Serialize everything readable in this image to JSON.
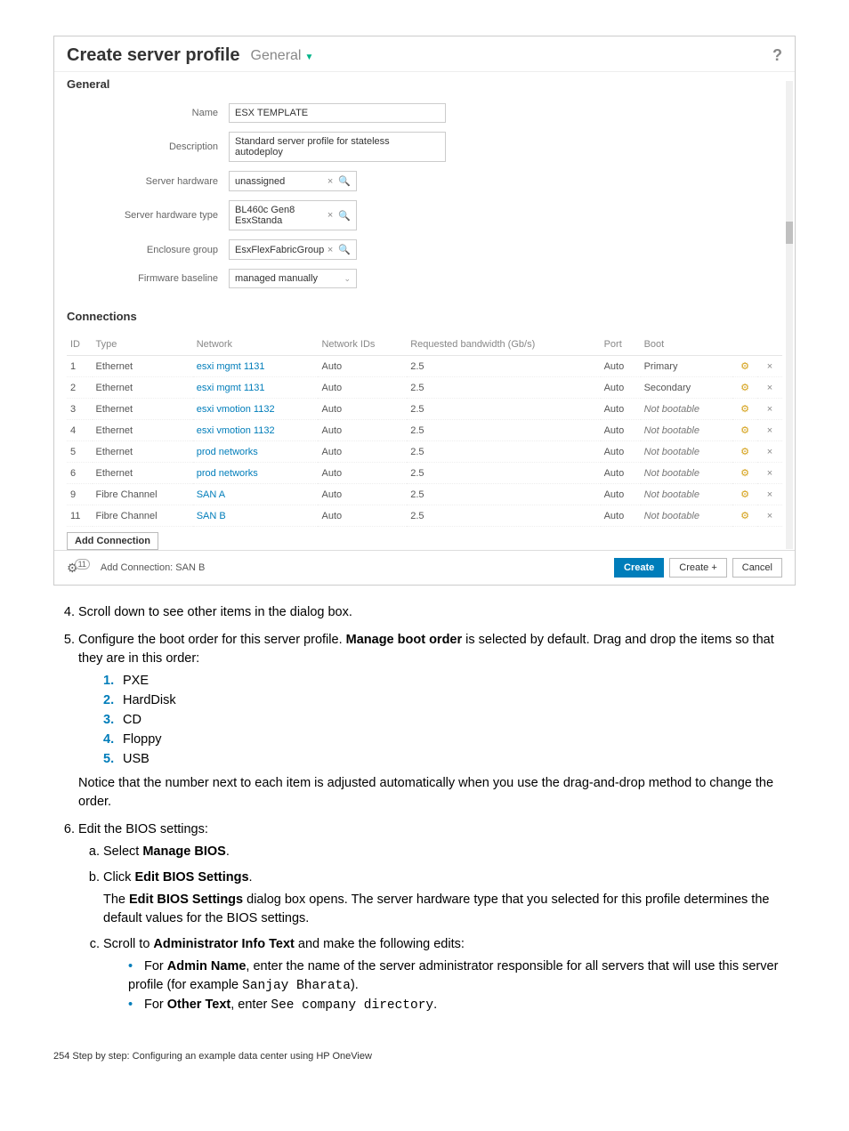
{
  "screenshot": {
    "title": "Create server profile",
    "dropdown": "General",
    "help": "?",
    "section_general": "General",
    "fields": {
      "name_label": "Name",
      "name_value": "ESX TEMPLATE",
      "desc_label": "Description",
      "desc_value": "Standard server profile for stateless autodeploy",
      "hw_label": "Server hardware",
      "hw_value": "unassigned",
      "hwtype_label": "Server hardware type",
      "hwtype_value": "BL460c Gen8 EsxStanda",
      "enc_label": "Enclosure group",
      "enc_value": "EsxFlexFabricGroup",
      "fw_label": "Firmware baseline",
      "fw_value": "managed manually"
    },
    "section_conn": "Connections",
    "headers": {
      "id": "ID",
      "type": "Type",
      "network": "Network",
      "nids": "Network IDs",
      "bw": "Requested bandwidth (Gb/s)",
      "port": "Port",
      "boot": "Boot"
    },
    "rows": [
      {
        "id": "1",
        "type": "Ethernet",
        "network": "esxi mgmt 1131",
        "nids": "Auto",
        "bw": "2.5",
        "port": "Auto",
        "boot": "Primary",
        "italic": false
      },
      {
        "id": "2",
        "type": "Ethernet",
        "network": "esxi mgmt 1131",
        "nids": "Auto",
        "bw": "2.5",
        "port": "Auto",
        "boot": "Secondary",
        "italic": false
      },
      {
        "id": "3",
        "type": "Ethernet",
        "network": "esxi vmotion 1132",
        "nids": "Auto",
        "bw": "2.5",
        "port": "Auto",
        "boot": "Not bootable",
        "italic": true
      },
      {
        "id": "4",
        "type": "Ethernet",
        "network": "esxi vmotion 1132",
        "nids": "Auto",
        "bw": "2.5",
        "port": "Auto",
        "boot": "Not bootable",
        "italic": true
      },
      {
        "id": "5",
        "type": "Ethernet",
        "network": "prod networks",
        "nids": "Auto",
        "bw": "2.5",
        "port": "Auto",
        "boot": "Not bootable",
        "italic": true
      },
      {
        "id": "6",
        "type": "Ethernet",
        "network": "prod networks",
        "nids": "Auto",
        "bw": "2.5",
        "port": "Auto",
        "boot": "Not bootable",
        "italic": true
      },
      {
        "id": "9",
        "type": "Fibre Channel",
        "network": "SAN A",
        "nids": "Auto",
        "bw": "2.5",
        "port": "Auto",
        "boot": "Not bootable",
        "italic": true
      },
      {
        "id": "11",
        "type": "Fibre Channel",
        "network": "SAN B",
        "nids": "Auto",
        "bw": "2.5",
        "port": "Auto",
        "boot": "Not bootable",
        "italic": true
      }
    ],
    "add_connection": "Add Connection",
    "footer_status_count": "11",
    "footer_status": "Add Connection: SAN B",
    "btn_create": "Create",
    "btn_create_plus": "Create +",
    "btn_cancel": "Cancel"
  },
  "doc": {
    "step4": "Scroll down to see other items in the dialog box.",
    "step5_a": "Configure the boot order for this server profile. ",
    "step5_b": "Manage boot order",
    "step5_c": " is selected by default. Drag and drop the items so that they are in this order:",
    "bootlist": [
      "PXE",
      "HardDisk",
      "CD",
      "Floppy",
      "USB"
    ],
    "step5_note": "Notice that the number next to each item is adjusted automatically when you use the drag-and-drop method to change the order.",
    "step6": "Edit the BIOS settings:",
    "s6a_a": "Select ",
    "s6a_b": "Manage BIOS",
    "s6a_c": ".",
    "s6b_a": "Click ",
    "s6b_b": "Edit BIOS Settings",
    "s6b_c": ".",
    "s6b_p_a": "The ",
    "s6b_p_b": "Edit BIOS Settings",
    "s6b_p_c": " dialog box opens. The server hardware type that you selected for this profile determines the default values for the BIOS settings.",
    "s6c_a": "Scroll to ",
    "s6c_b": "Administrator Info Text",
    "s6c_c": " and make the following edits:",
    "s6c_b1_a": "For ",
    "s6c_b1_b": "Admin Name",
    "s6c_b1_c": ", enter the name of the server administrator responsible for all servers that will use this server profile (for example ",
    "s6c_b1_d": "Sanjay Bharata",
    "s6c_b1_e": ").",
    "s6c_b2_a": "For ",
    "s6c_b2_b": "Other Text",
    "s6c_b2_c": ", enter ",
    "s6c_b2_d": "See company directory",
    "s6c_b2_e": ".",
    "page_footer": "254   Step by step: Configuring an example data center using HP OneView"
  }
}
